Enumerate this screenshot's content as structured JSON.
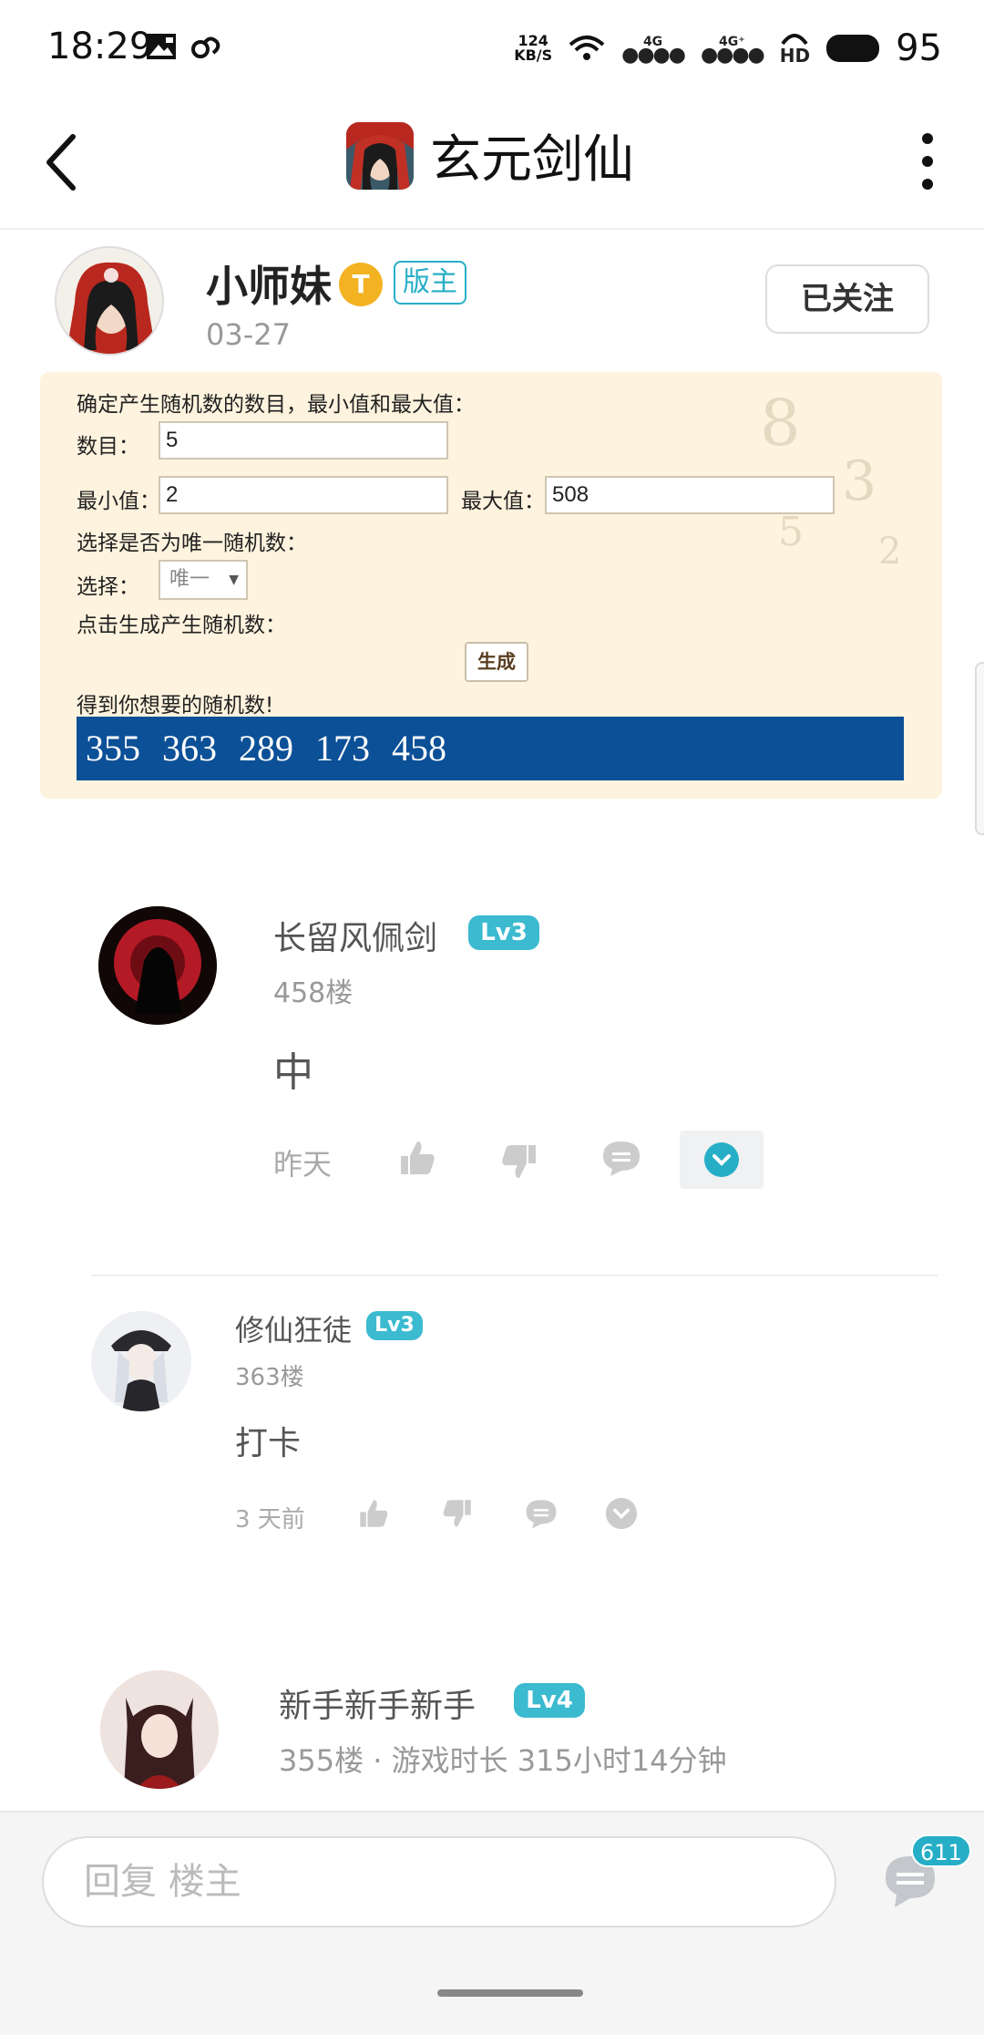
{
  "status_bar": {
    "time": "18:29",
    "net_speed_value": "124",
    "net_speed_unit": "KB/S",
    "net1": "4G",
    "net2": "4G⁺",
    "hd": "HD",
    "battery": "95"
  },
  "nav": {
    "title": "玄元剑仙"
  },
  "post": {
    "author": "小师妹",
    "author_badge": "T",
    "role_badge": "版主",
    "date": "03-27",
    "follow_label": "已关注"
  },
  "rng": {
    "intro": "确定产生随机数的数目，最小值和最大值：",
    "count_label": "数目：",
    "count_value": "5",
    "min_label": "最小值：",
    "min_value": "2",
    "max_label": "最大值：",
    "max_value": "508",
    "unique_intro": "选择是否为唯一随机数：",
    "select_label": "选择：",
    "select_value": "唯一",
    "generate_intro": "点击生成产生随机数：",
    "generate_button": "生成",
    "result_intro": "得到你想要的随机数!",
    "result": "355  363  289  173  458"
  },
  "comments": [
    {
      "name": "长留风佩剑",
      "level": "Lv3",
      "floor": "458楼",
      "body": "中",
      "time": "昨天"
    },
    {
      "name": "修仙狂徒",
      "level": "Lv3",
      "floor": "363楼",
      "body": "打卡",
      "time": "3 天前"
    },
    {
      "name": "新手新手新手",
      "level": "Lv4",
      "floor": "355楼 · 游戏时长 315小时14分钟"
    }
  ],
  "reply": {
    "placeholder": "回复  楼主",
    "comment_count": "611"
  },
  "colors": {
    "accent": "#26aec6",
    "result_bg": "#0c5097",
    "panel_bg": "#fdf3de"
  }
}
